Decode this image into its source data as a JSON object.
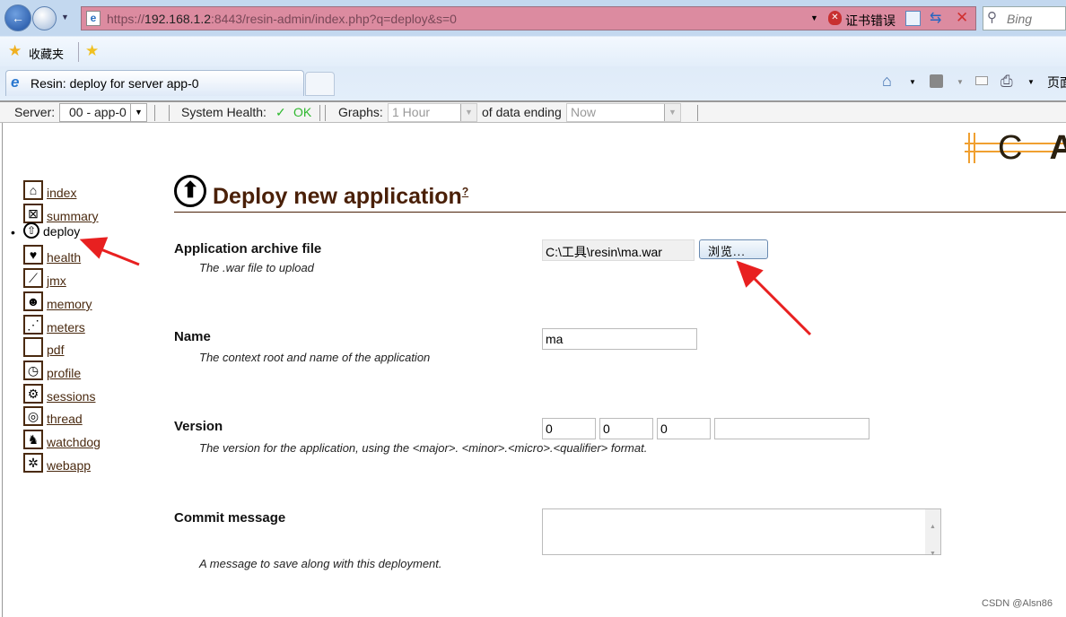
{
  "browser": {
    "url_prefix": "https://",
    "url_host": "192.168.1.2",
    "url_rest": ":8443/resin-admin/index.php?q=deploy&s=0",
    "cert_error": "证书错误",
    "search_placeholder": "Bing",
    "favorites_label": "收藏夹",
    "tab_title": "Resin: deploy for server app-0",
    "page_menu": "页面"
  },
  "toolbar": {
    "server_label": "Server:",
    "server_value": "00 - app-0",
    "health_label": "System Health:",
    "health_check": "✓",
    "health_value": "OK",
    "graphs_label": "Graphs:",
    "graphs_value": "1 Hour",
    "ending_label": "of data ending",
    "ending_value": "Now"
  },
  "logo": "C A",
  "sidebar": {
    "items": [
      {
        "label": "index",
        "icon": "house-icon",
        "glyph": "⌂"
      },
      {
        "label": "summary",
        "icon": "gift-icon",
        "glyph": "⊠"
      },
      {
        "label": "deploy",
        "icon": "upload-icon",
        "glyph": "⇧",
        "active": true
      },
      {
        "label": "health",
        "icon": "heart-icon",
        "glyph": "♥"
      },
      {
        "label": "jmx",
        "icon": "wrench-icon",
        "glyph": "⟋"
      },
      {
        "label": "memory",
        "icon": "head-icon",
        "glyph": "☻"
      },
      {
        "label": "meters",
        "icon": "chart-icon",
        "glyph": "⋰"
      },
      {
        "label": "pdf",
        "icon": "document-icon",
        "glyph": " "
      },
      {
        "label": "profile",
        "icon": "stopwatch-icon",
        "glyph": "◷"
      },
      {
        "label": "sessions",
        "icon": "gears-icon",
        "glyph": "⚙"
      },
      {
        "label": "thread",
        "icon": "yarn-icon",
        "glyph": "◎"
      },
      {
        "label": "watchdog",
        "icon": "dog-icon",
        "glyph": "♞"
      },
      {
        "label": "webapp",
        "icon": "web-icon",
        "glyph": "✲"
      }
    ]
  },
  "main": {
    "title": "Deploy new application",
    "help": "?",
    "fields": {
      "archive": {
        "label": "Application archive file",
        "desc": "The .war file to upload",
        "value": "C:\\工具\\resin\\ma.war",
        "browse": "浏览..."
      },
      "name": {
        "label": "Name",
        "desc": "The context root and name of the application",
        "value": "ma"
      },
      "version": {
        "label": "Version",
        "desc": "The version for the application, using the <major>. <minor>.<micro>.<qualifier> format.",
        "major": "0",
        "minor": "0",
        "micro": "0",
        "qualifier": ""
      },
      "commit": {
        "label": "Commit message",
        "desc": "A message to save along with this deployment.",
        "value": ""
      }
    }
  },
  "watermark": "CSDN @Alsn86",
  "colors": {
    "link": "#4a2a10",
    "ok": "#2eb82e",
    "address_error": "#dc8ba0",
    "logo_accent": "#f0a030"
  }
}
